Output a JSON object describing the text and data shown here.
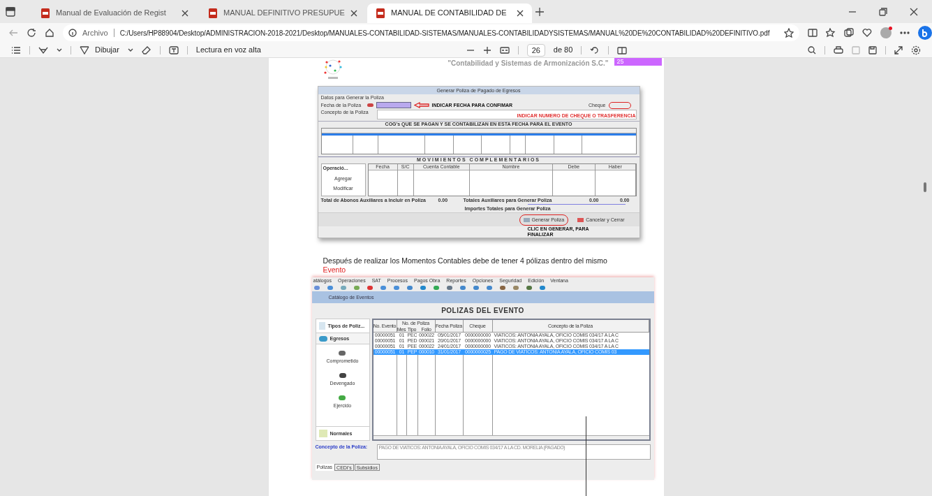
{
  "browser": {
    "tabs": [
      {
        "label": "Manual de Evaluación de Regist",
        "selected": false
      },
      {
        "label": "MANUAL DEFINITIVO PRESUPUE",
        "selected": false
      },
      {
        "label": "MANUAL DE CONTABILIDAD DE",
        "selected": true
      }
    ],
    "address": {
      "prefix": "Archivo",
      "url": "C:/Users/HP88904/Desktop/ADMINISTRACION-2018-2021/Desktop/MANUALES-CONTABILIDAD-SISTEMAS/MANUALES-CONTABILIDADYSISTEMAS/MANUAL%20DE%20CONTABILIDAD%20DEFINITIVO.pdf"
    }
  },
  "pdf_toolbar": {
    "draw": "Dibujar",
    "read_aloud": "Lectura en voz alta",
    "page": "26",
    "page_total": "de 80"
  },
  "page": {
    "header": {
      "company": "\"Contabilidad y Sistemas de Armonización S.C.\"",
      "page_number": "25"
    },
    "figure_1": {
      "title": "Generar Poliza de Pagado de Egresos",
      "section_label": "Datos para Generar la Poliza",
      "date_label": "Fecha de la Poliza",
      "concept_label": "Concepto de la Poliza",
      "date_note": "INDICAR FECHA PARA CONFIMAR",
      "cheque_label": "Cheque",
      "cheque_note": "INDICAR NUMERO DE CHEQUE O TRASFERENCIA",
      "cog_heading": "COG's QUE SE PAGAN Y SE CONTABILIZAN EN ESTA FECHA PARA EL EVENTO",
      "movements_heading": "MOVIMIENTOS COMPLEMENTARIOS",
      "movement_columns": [
        "Fecha",
        "S/C",
        "Cuenta Contable",
        "Nombre",
        "Debe",
        "Haber"
      ],
      "side_header": "Operació...",
      "side_items": [
        "Agregar",
        "Modificar"
      ],
      "credits_label": "Total de Abonos Auxiliares a Incluir en Poliza",
      "credits_value": "0.00",
      "aux_label": "Totales Auxiliares para Generar Poliza",
      "aux_values": [
        "0.00",
        "0.00"
      ],
      "totals_label": "Importes Totales para Generar Poliza",
      "buttons": [
        "Generar Poliza",
        "Cancelar y Cerrar"
      ],
      "finish_note": "CLIC EN GENERAR, PARA FINALIZAR"
    },
    "paragraph": {
      "text": "Después de realizar los Momentos Contables debe de tener 4 pólizas dentro del mismo",
      "highlight": "Evento"
    },
    "figure_2": {
      "menu": [
        "atálogos",
        "Operaciones",
        "SAT",
        "Procesos",
        "Pagos Obra",
        "Reportes",
        "Opciones",
        "Seguridad",
        "Edición",
        "Ventana"
      ],
      "window_title": "Catálogo de Eventos",
      "heading": "POLIZAS DEL EVENTO",
      "sidebar": {
        "top": "Tipos de Poliz...",
        "group": "Egresos",
        "items": [
          "Comprometido",
          "Devengado",
          "Ejercido"
        ],
        "bottom": "Normales"
      },
      "group_header": "No. de Poliza",
      "columns": [
        "No. Evento",
        "Mes",
        "Tipo",
        "Folio",
        "Fecha Poliza",
        "Cheque",
        "Concepto de la Poliza"
      ],
      "rows": [
        {
          "selected": false,
          "cells": [
            "00000051",
            "01",
            "PEC",
            "000022",
            "05/01/2017",
            "0000000000",
            "VIATICOS: ANTONIA AYALA, OFICIO COMIS 034/17 A LA C"
          ]
        },
        {
          "selected": false,
          "cells": [
            "00000051",
            "01",
            "PED",
            "000021",
            "20/01/2017",
            "0000000000",
            "VIATICOS: ANTONIA AYALA, OFICIO COMIS 034/17 A LA C"
          ]
        },
        {
          "selected": false,
          "cells": [
            "00000051",
            "01",
            "PEE",
            "000022",
            "24/01/2017",
            "0000000000",
            "VIATICOS: ANTONIA AYALA, OFICIO COMIS 034/17 A LA C"
          ]
        },
        {
          "selected": true,
          "cells": [
            "00000051",
            "01",
            "PEP",
            "000010",
            "31/01/2017",
            "0000000025",
            "PAGO DE VIATICOS: ANTONIA AYALA, OFICIO COMIS 03"
          ]
        }
      ],
      "concept_label": "Concepto de la Poliza:",
      "concept_value": "PAGO DE VIATICOS: ANTONIA AYALA, OFICIO COMIS 034/17 A LA CD. MORELIA (PAGADO)",
      "tabs": [
        {
          "label": "Polizas",
          "selected": true
        },
        {
          "label": "CEDI's",
          "selected": false
        },
        {
          "label": "Subsidios",
          "selected": false
        }
      ]
    }
  }
}
